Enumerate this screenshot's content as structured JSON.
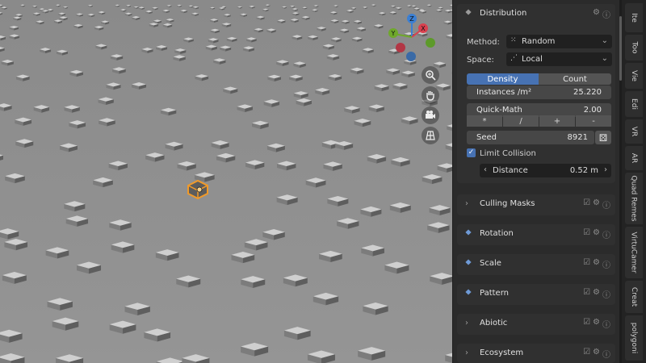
{
  "viewport": {
    "gizmo": {
      "z": "Z",
      "y": "Y",
      "x": "X"
    },
    "nav_icons": [
      "zoom-icon",
      "hand-icon",
      "camera-icon",
      "grid-icon"
    ]
  },
  "panel": {
    "distribution": {
      "title": "Distribution",
      "method_label": "Method:",
      "method_value": "Random",
      "space_label": "Space:",
      "space_value": "Local",
      "tab_density": "Density",
      "tab_count": "Count",
      "instances_label": "Instances /m²",
      "instances_value": "25.220",
      "quickmath_label": "Quick-Math",
      "quickmath_value": "2.00",
      "ops": [
        "*",
        "/",
        "+",
        "-"
      ],
      "seed_label": "Seed",
      "seed_value": "8921",
      "limit_collision_label": "Limit Collision",
      "limit_collision_checked": true,
      "distance_label": "Distance",
      "distance_value": "0.52 m"
    },
    "sections": [
      {
        "title": "Culling Masks",
        "expand": "›"
      },
      {
        "title": "Rotation",
        "expand": "⯁"
      },
      {
        "title": "Scale",
        "expand": "⯁"
      },
      {
        "title": "Pattern",
        "expand": "⯁"
      },
      {
        "title": "Abiotic",
        "expand": "›"
      },
      {
        "title": "Ecosystem",
        "expand": "›"
      }
    ]
  },
  "tabs": [
    "Ite",
    "Too",
    "Vie",
    "Edi",
    "VR",
    "AR",
    "Quad Remes",
    "VirtuCamer",
    "Creat",
    "polygoni"
  ],
  "colors": {
    "accent": "#4772b3",
    "panel": "#303030",
    "viewport": "#8f8f8f",
    "selected": "#f09a2a"
  }
}
